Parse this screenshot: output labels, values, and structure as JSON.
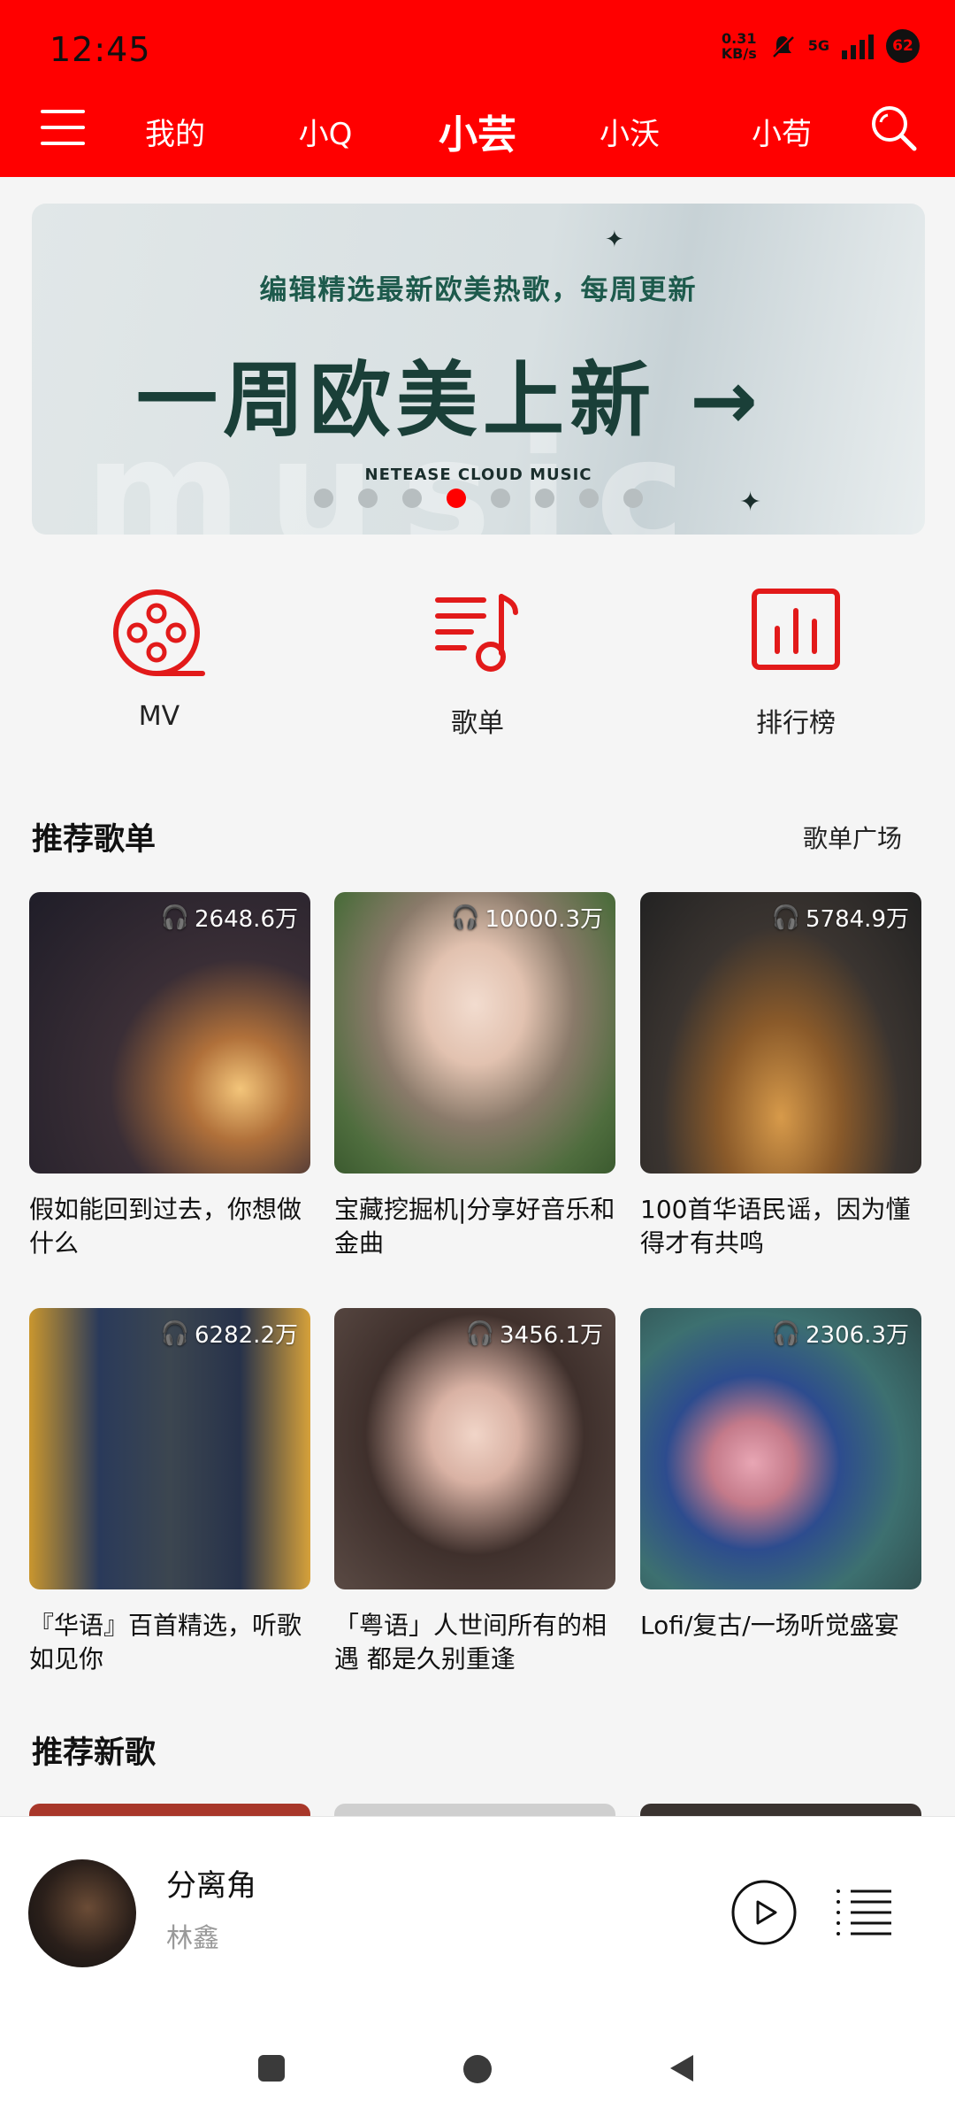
{
  "status_bar": {
    "time": "12:45",
    "net_speed_value": "0.31",
    "net_speed_unit": "KB/s",
    "signal_label": "5G",
    "battery": "62"
  },
  "header": {
    "menu_icon": "hamburger-menu-icon",
    "tabs": [
      {
        "label": "我的"
      },
      {
        "label": "小Q"
      },
      {
        "label": "小芸",
        "active": true
      },
      {
        "label": "小沃"
      },
      {
        "label": "小苟"
      }
    ],
    "search_icon": "search-icon",
    "brand_color": "#ff0000"
  },
  "banner": {
    "subtitle": "编辑精选最新欧美热歌，每周更新",
    "title": "一周欧美上新 →",
    "brand": "NETEASE CLOUD MUSIC",
    "watermark": "music",
    "dot_count": 8,
    "active_dot": 4
  },
  "quick_entries": [
    {
      "label": "MV",
      "icon": "film-reel-icon"
    },
    {
      "label": "歌单",
      "icon": "playlist-note-icon"
    },
    {
      "label": "排行榜",
      "icon": "chart-bars-icon"
    }
  ],
  "recommended_playlists": {
    "title": "推荐歌单",
    "more_label": "歌单广场",
    "items": [
      {
        "count": "2648.6万",
        "caption": "假如能回到过去，你想做什么",
        "palette": [
          "#2b2a35",
          "#6b4a3a",
          "#e9b36a"
        ]
      },
      {
        "count": "10000.3万",
        "caption": "宝藏挖掘机|分享好音乐和金曲",
        "palette": [
          "#c9c3b8",
          "#e9d1c2",
          "#4a6b3a"
        ]
      },
      {
        "count": "5784.9万",
        "caption": "100首华语民谣，因为懂得才有共鸣",
        "palette": [
          "#262626",
          "#5a4a3a",
          "#c98a3a"
        ]
      },
      {
        "count": "6282.2万",
        "caption": "『华语』百首精选，听歌如见你",
        "palette": [
          "#1f2d45",
          "#3a4a5a",
          "#d9a43a"
        ]
      },
      {
        "count": "3456.1万",
        "caption": "「粤语」人世间所有的相遇 都是久别重逢",
        "palette": [
          "#4a3a36",
          "#e6c8bc",
          "#8a6a5a"
        ]
      },
      {
        "count": "2306.3万",
        "caption": "Lofi/复古/一场听觉盛宴",
        "palette": [
          "#3a6a6a",
          "#e6b8a8",
          "#2a4a8a"
        ]
      }
    ]
  },
  "recommended_songs": {
    "title": "推荐新歌"
  },
  "mini_player": {
    "title": "分离角",
    "artist": "林鑫",
    "play_icon": "play-icon",
    "list_icon": "playlist-icon"
  },
  "system_nav": {
    "recent_icon": "recent-apps-icon",
    "home_icon": "home-icon",
    "back_icon": "back-icon"
  }
}
